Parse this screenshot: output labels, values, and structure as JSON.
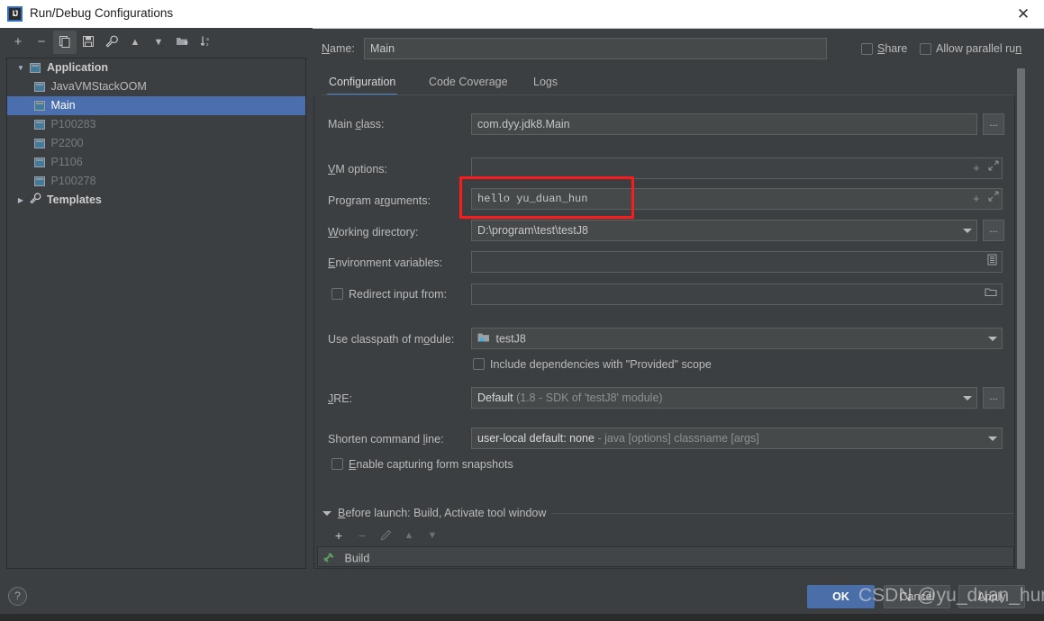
{
  "window": {
    "title": "Run/Debug Configurations",
    "icon": "intellij-idea-icon",
    "close_label": "✕"
  },
  "left_toolbar": {
    "buttons": [
      {
        "name": "add-configuration-button",
        "glyph": "+",
        "highlighted": false
      },
      {
        "name": "remove-configuration-button",
        "glyph": "−",
        "highlighted": false
      },
      {
        "name": "copy-configuration-button",
        "glyph": "copy-icon",
        "highlighted": true
      },
      {
        "name": "save-configuration-button",
        "glyph": "save-icon",
        "highlighted": false
      },
      {
        "name": "edit-templates-button",
        "glyph": "wrench-icon",
        "highlighted": false
      },
      {
        "name": "move-up-button",
        "glyph": "▲",
        "highlighted": false
      },
      {
        "name": "move-down-button",
        "glyph": "▼",
        "highlighted": false
      },
      {
        "name": "new-folder-button",
        "glyph": "folder-plus-icon",
        "highlighted": false
      },
      {
        "name": "sort-configurations-button",
        "glyph": "sort-az-icon",
        "highlighted": false
      }
    ]
  },
  "tree": {
    "items": [
      {
        "label": "Application",
        "level": 0,
        "twisty": "▼",
        "style": "bold",
        "selected": false,
        "icon": "application-icon"
      },
      {
        "label": "JavaVMStackOOM",
        "level": 1,
        "twisty": "",
        "style": "nrm",
        "selected": false,
        "icon": "run-config-icon"
      },
      {
        "label": "Main",
        "level": 1,
        "twisty": "",
        "style": "nrm",
        "selected": true,
        "icon": "run-config-icon"
      },
      {
        "label": "P100283",
        "level": 1,
        "twisty": "",
        "style": "dim",
        "selected": false,
        "icon": "run-config-icon"
      },
      {
        "label": "P2200",
        "level": 1,
        "twisty": "",
        "style": "dim",
        "selected": false,
        "icon": "run-config-icon"
      },
      {
        "label": "P1106",
        "level": 1,
        "twisty": "",
        "style": "dim",
        "selected": false,
        "icon": "run-config-icon"
      },
      {
        "label": "P100278",
        "level": 1,
        "twisty": "",
        "style": "dim",
        "selected": false,
        "icon": "run-config-icon"
      },
      {
        "label": "Templates",
        "level": 0,
        "twisty": "▶",
        "style": "bold",
        "selected": false,
        "icon": "templates-wrench-icon"
      }
    ]
  },
  "header": {
    "name_label": "Name:",
    "name_value": "Main",
    "share_label": "Share",
    "share_checked": false,
    "allow_parallel_label": "Allow parallel run",
    "allow_parallel_checked": false
  },
  "tabs": [
    {
      "label": "Configuration",
      "active": true
    },
    {
      "label": "Code Coverage",
      "active": false
    },
    {
      "label": "Logs",
      "active": false
    }
  ],
  "form": {
    "main_class": {
      "label": "Main class:",
      "value": "com.dyy.jdk8.Main",
      "browse": "..."
    },
    "vm_options": {
      "label": "VM options:",
      "value": "",
      "expand_icon": "expand-icon",
      "add_icon": "plus-icon"
    },
    "program_arguments": {
      "label": "Program arguments:",
      "value": "hello yu_duan_hun",
      "expand_icon": "expand-icon",
      "add_icon": "plus-icon",
      "highlighted": true
    },
    "working_directory": {
      "label": "Working directory:",
      "value": "D:\\program\\test\\testJ8",
      "browse": "..."
    },
    "environment_variables": {
      "label": "Environment variables:",
      "value": "",
      "editor_icon": "list-editor-icon"
    },
    "redirect_input": {
      "label": "Redirect input from:",
      "value": "",
      "checked": false,
      "folder_icon": "folder-icon"
    },
    "classpath_module": {
      "label": "Use classpath of module:",
      "value": "testJ8",
      "icon": "module-icon"
    },
    "include_provided": {
      "label": "Include dependencies with \"Provided\" scope",
      "checked": false
    },
    "jre": {
      "label": "JRE:",
      "value_main": "Default",
      "value_detail": "(1.8 - SDK of 'testJ8' module)",
      "browse": "..."
    },
    "shorten_command_line": {
      "label": "Shorten command line:",
      "value_main": "user-local default: none",
      "value_detail": "- java [options] classname [args]"
    },
    "form_snapshots": {
      "label": "Enable capturing form snapshots",
      "checked": false
    }
  },
  "before_launch": {
    "title": "Before launch: Build, Activate tool window",
    "toolbar": [
      {
        "name": "add-task-button",
        "glyph": "+",
        "enabled": true
      },
      {
        "name": "remove-task-button",
        "glyph": "−",
        "enabled": false
      },
      {
        "name": "edit-task-button",
        "glyph": "pencil-icon",
        "enabled": false
      },
      {
        "name": "move-task-up-button",
        "glyph": "▲",
        "enabled": false
      },
      {
        "name": "move-task-down-button",
        "glyph": "▼",
        "enabled": false
      }
    ],
    "tasks": [
      {
        "label": "Build",
        "icon": "hammer-icon"
      }
    ]
  },
  "footer": {
    "help_label": "?",
    "ok_label": "OK",
    "cancel_label": "Cancel",
    "apply_label": "Apply"
  },
  "watermark": "CSDN @yu_duan_hun",
  "colors": {
    "background": "#3c3f41",
    "field": "#45494a",
    "selection": "#4b6eaf",
    "accent": "#4a88c7",
    "primary_button": "#4a6ea8",
    "annotation": "#fa1c1c",
    "build_icon": "#5f9e5f"
  }
}
